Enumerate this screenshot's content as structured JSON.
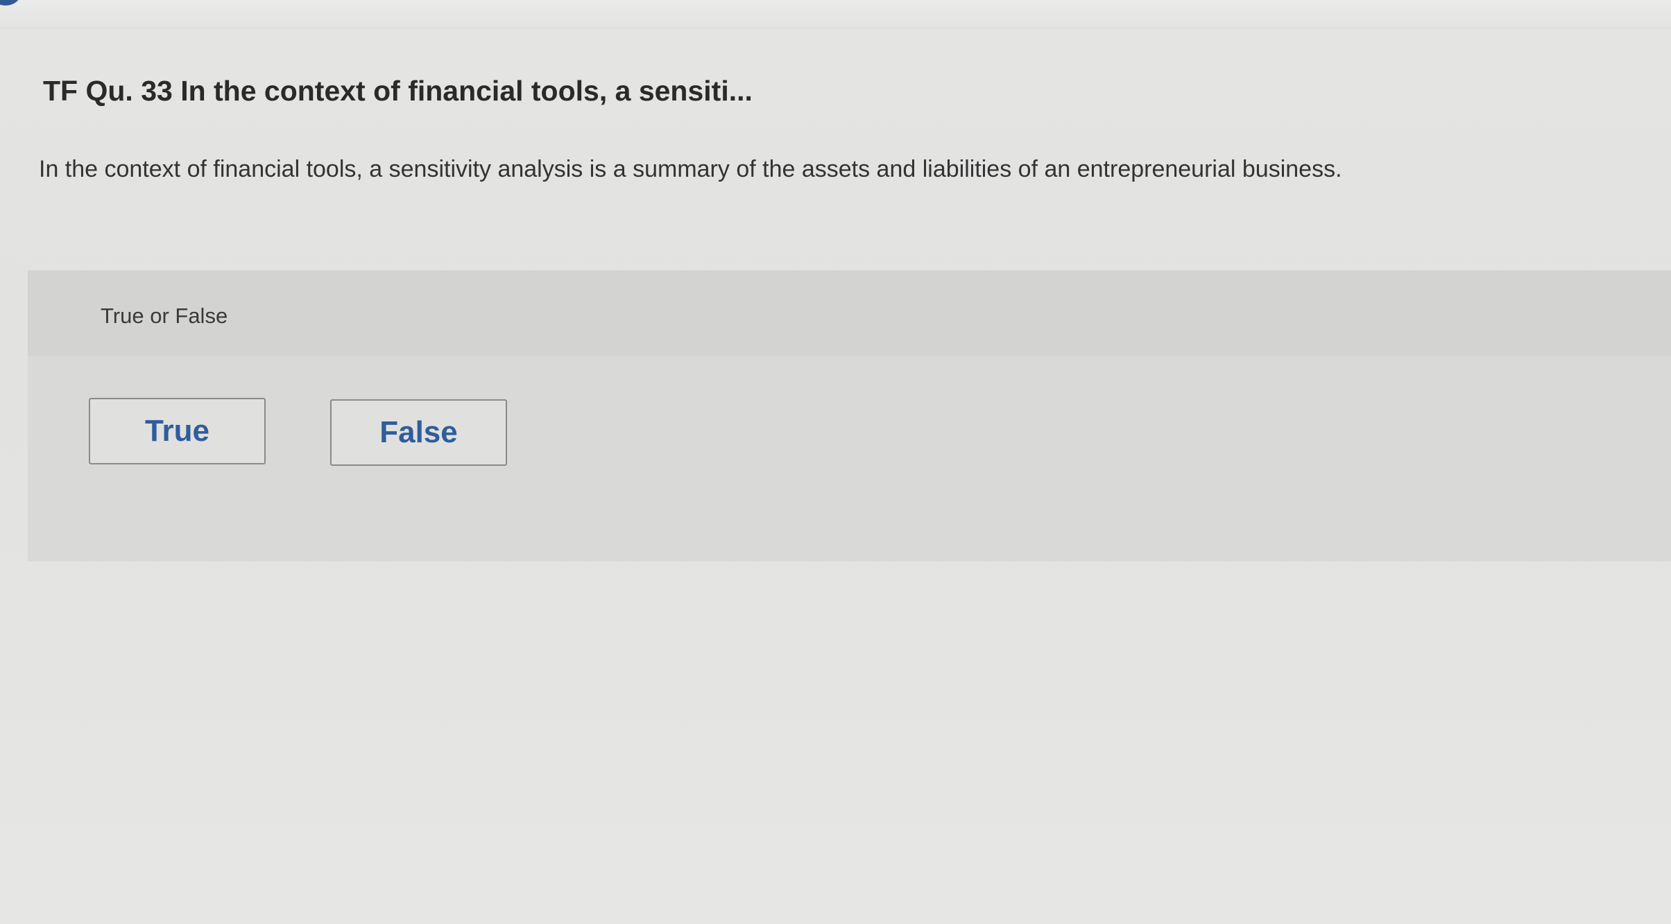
{
  "question": {
    "title": "TF Qu. 33 In the context of financial tools, a sensiti...",
    "text": "In the context of financial tools, a sensitivity analysis is a summary of the assets and liabilities of an entrepreneurial business."
  },
  "answer_area": {
    "type_label": "True or False",
    "options": [
      {
        "label": "True"
      },
      {
        "label": "False"
      }
    ]
  },
  "colors": {
    "button_text": "#2f5d9b",
    "badge": "#2f5b93",
    "panel_bg": "#d9d9d7"
  }
}
